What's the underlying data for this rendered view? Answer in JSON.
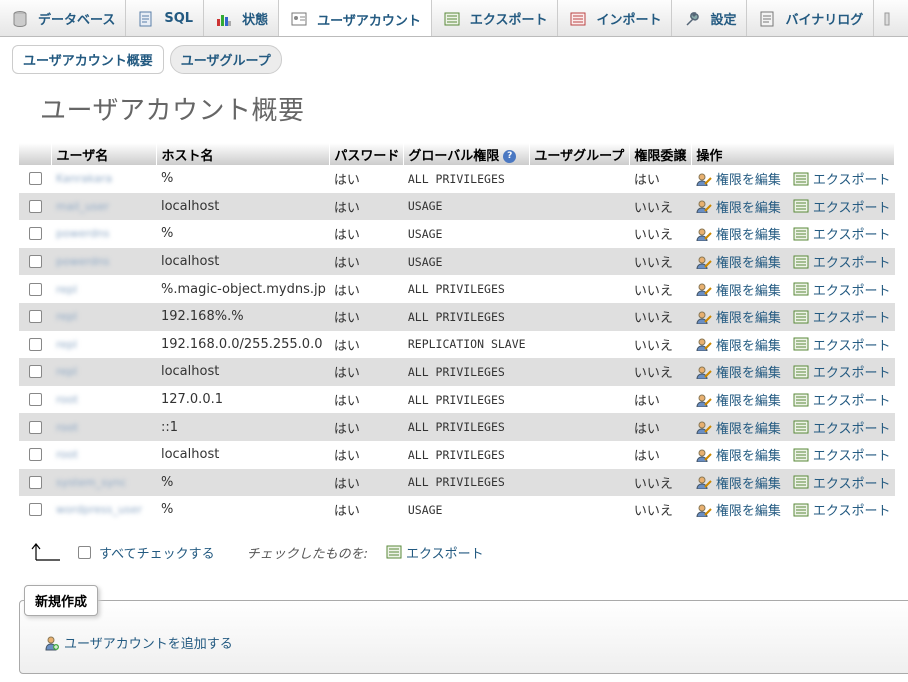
{
  "tabs": [
    {
      "label": "データベース",
      "icon": "database-icon"
    },
    {
      "label": "SQL",
      "icon": "sql-icon"
    },
    {
      "label": "状態",
      "icon": "status-icon"
    },
    {
      "label": "ユーザアカウント",
      "icon": "user-accounts-icon",
      "active": true
    },
    {
      "label": "エクスポート",
      "icon": "export-icon"
    },
    {
      "label": "インポート",
      "icon": "import-icon"
    },
    {
      "label": "設定",
      "icon": "wrench-icon"
    },
    {
      "label": "バイナリログ",
      "icon": "binary-log-icon"
    }
  ],
  "subtabs": {
    "overview": "ユーザアカウント概要",
    "groups": "ユーザグループ"
  },
  "page_title": "ユーザアカウント概要",
  "table": {
    "headers": {
      "user": "ユーザ名",
      "host": "ホスト名",
      "password": "パスワード",
      "global": "グローバル権限",
      "group": "ユーザグループ",
      "grant": "権限委譲",
      "action": "操作"
    },
    "action_labels": {
      "edit": "権限を編集",
      "export": "エクスポート"
    },
    "rows": [
      {
        "user": "Kanrakara",
        "host": "%",
        "password": "はい",
        "priv": "ALL PRIVILEGES",
        "grant": "はい"
      },
      {
        "user": "mail_user",
        "host": "localhost",
        "password": "はい",
        "priv": "USAGE",
        "grant": "いいえ"
      },
      {
        "user": "powerdns",
        "host": "%",
        "password": "はい",
        "priv": "USAGE",
        "grant": "いいえ"
      },
      {
        "user": "powerdns",
        "host": "localhost",
        "password": "はい",
        "priv": "USAGE",
        "grant": "いいえ"
      },
      {
        "user": "repl",
        "host": "%.magic-object.mydns.jp",
        "password": "はい",
        "priv": "ALL PRIVILEGES",
        "grant": "いいえ"
      },
      {
        "user": "repl",
        "host": "192.168%.%",
        "password": "はい",
        "priv": "ALL PRIVILEGES",
        "grant": "いいえ"
      },
      {
        "user": "repl",
        "host": "192.168.0.0/255.255.0.0",
        "password": "はい",
        "priv": "REPLICATION SLAVE",
        "grant": "いいえ"
      },
      {
        "user": "repl",
        "host": "localhost",
        "password": "はい",
        "priv": "ALL PRIVILEGES",
        "grant": "いいえ"
      },
      {
        "user": "root",
        "host": "127.0.0.1",
        "password": "はい",
        "priv": "ALL PRIVILEGES",
        "grant": "はい"
      },
      {
        "user": "root",
        "host": "::1",
        "password": "はい",
        "priv": "ALL PRIVILEGES",
        "grant": "はい"
      },
      {
        "user": "root",
        "host": "localhost",
        "password": "はい",
        "priv": "ALL PRIVILEGES",
        "grant": "はい"
      },
      {
        "user": "system_sync",
        "host": "%",
        "password": "はい",
        "priv": "ALL PRIVILEGES",
        "grant": "いいえ"
      },
      {
        "user": "wordpress_user",
        "host": "%",
        "password": "はい",
        "priv": "USAGE",
        "grant": "いいえ"
      }
    ]
  },
  "footer": {
    "check_all": "すべてチェックする",
    "with_selected": "チェックしたものを:",
    "export": "エクスポート"
  },
  "new_section": {
    "legend": "新規作成",
    "add_user": "ユーザアカウントを追加する"
  },
  "colors": {
    "link": "#235a81",
    "row_alt": "#dfdfdf"
  }
}
